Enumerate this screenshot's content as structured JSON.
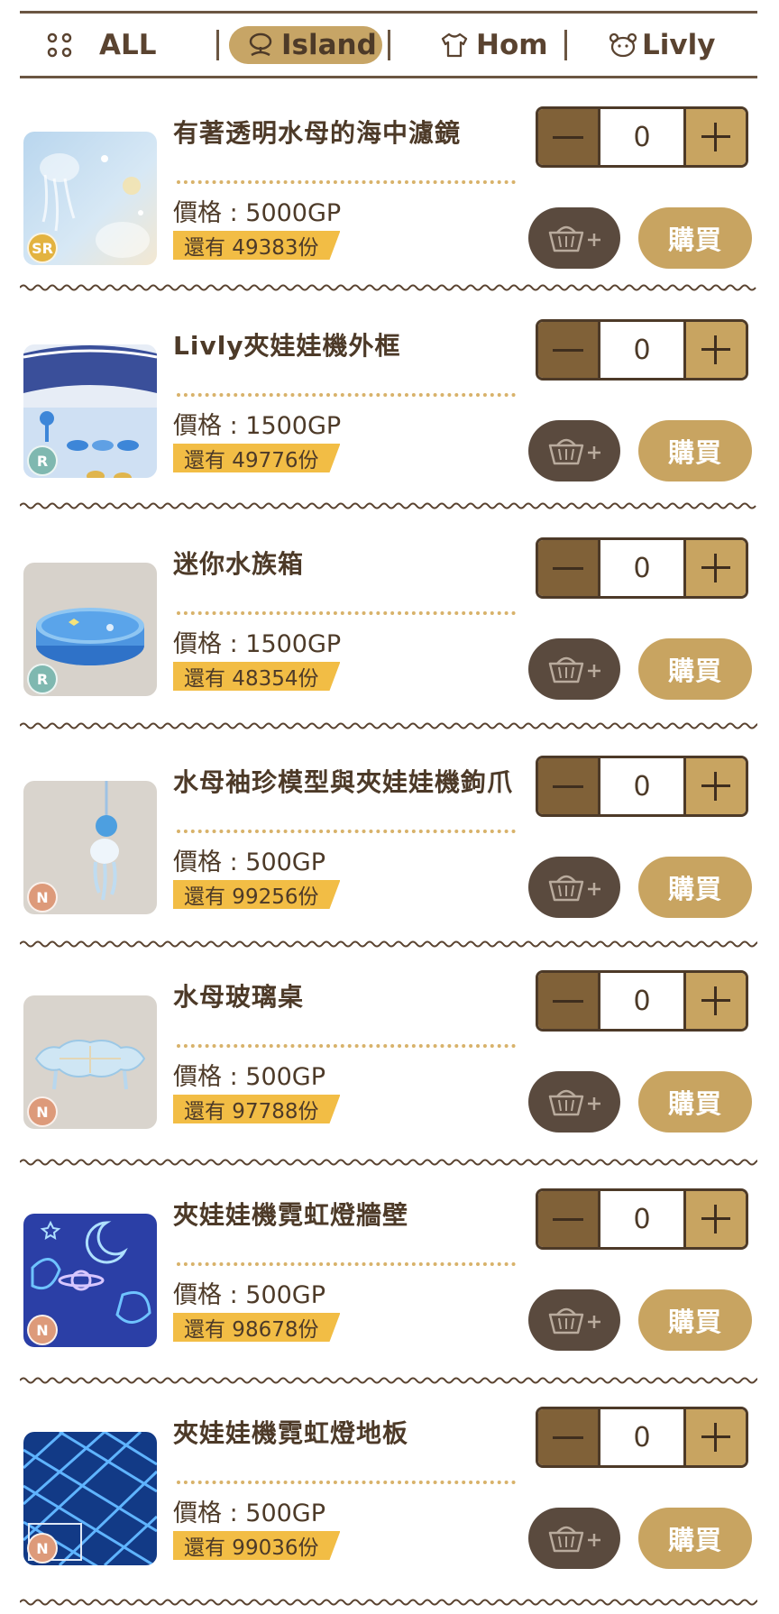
{
  "tabs": [
    {
      "label": "ALL",
      "icon": "grid-dots-icon"
    },
    {
      "label": "Island",
      "icon": "island-tree-icon",
      "active": true
    },
    {
      "label": "Hom",
      "icon": "shirt-icon"
    },
    {
      "label": "Livly",
      "icon": "livly-pet-icon"
    }
  ],
  "colors": {
    "accent_gold": "#c8a461",
    "dark_brown": "#4d3a28",
    "stock_yellow": "#f2bd45",
    "cart_dark": "#5a4a3e"
  },
  "buy_label": "購買",
  "items": [
    {
      "name": "有著透明水母的海中濾鏡",
      "price": "價格 : 5000GP",
      "stock": "還有 49383份",
      "rarity": "SR",
      "qty": "0"
    },
    {
      "name": "Livly夾娃娃機外框",
      "price": "價格 : 1500GP",
      "stock": "還有 49776份",
      "rarity": "R",
      "qty": "0"
    },
    {
      "name": "迷你水族箱",
      "price": "價格 : 1500GP",
      "stock": "還有 48354份",
      "rarity": "R",
      "qty": "0"
    },
    {
      "name": "水母袖珍模型與夾娃娃機鉤爪",
      "price": "價格 : 500GP",
      "stock": "還有 99256份",
      "rarity": "N",
      "qty": "0"
    },
    {
      "name": "水母玻璃桌",
      "price": "價格 : 500GP",
      "stock": "還有 97788份",
      "rarity": "N",
      "qty": "0"
    },
    {
      "name": "夾娃娃機霓虹燈牆壁",
      "price": "價格 : 500GP",
      "stock": "還有 98678份",
      "rarity": "N",
      "qty": "0"
    },
    {
      "name": "夾娃娃機霓虹燈地板",
      "price": "價格 : 500GP",
      "stock": "還有 99036份",
      "rarity": "N",
      "qty": "0"
    }
  ]
}
